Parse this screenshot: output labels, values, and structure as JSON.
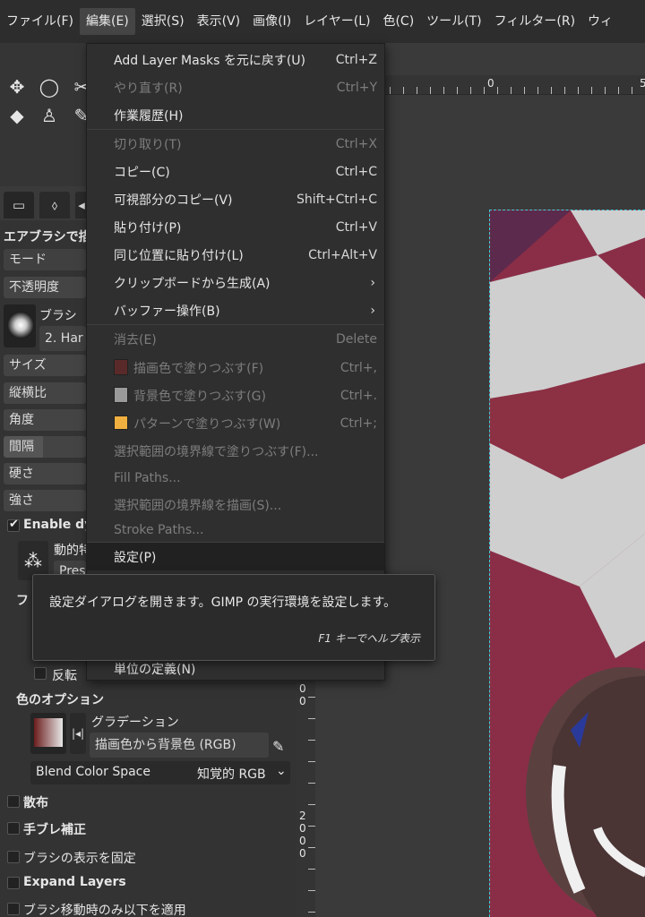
{
  "menubar": {
    "items": [
      "ファイル(F)",
      "編集(E)",
      "選択(S)",
      "表示(V)",
      "画像(I)",
      "レイヤー(L)",
      "色(C)",
      "ツール(T)",
      "フィルター(R)",
      "ウィ"
    ],
    "active_index": 1
  },
  "edit_menu": {
    "items": [
      {
        "label": "Add Layer Masks を元に戻す(U)",
        "accel": "Ctrl+Z",
        "disabled": false
      },
      {
        "label": "やり直す(R)",
        "accel": "Ctrl+Y",
        "disabled": true
      },
      {
        "label": "作業履歴(H)",
        "accel": "",
        "disabled": false
      },
      {
        "label": "切り取り(T)",
        "accel": "Ctrl+X",
        "disabled": true
      },
      {
        "label": "コピー(C)",
        "accel": "Ctrl+C",
        "disabled": false
      },
      {
        "label": "可視部分のコピー(V)",
        "accel": "Shift+Ctrl+C",
        "disabled": false
      },
      {
        "label": "貼り付け(P)",
        "accel": "Ctrl+V",
        "disabled": false
      },
      {
        "label": "同じ位置に貼り付け(L)",
        "accel": "Ctrl+Alt+V",
        "disabled": false
      },
      {
        "label": "クリップボードから生成(A)",
        "accel": "",
        "submenu": true,
        "disabled": false
      },
      {
        "label": "バッファー操作(B)",
        "accel": "",
        "submenu": true,
        "disabled": false
      },
      {
        "label": "消去(E)",
        "accel": "Delete",
        "disabled": true
      },
      {
        "label": "描画色で塗りつぶす(F)",
        "accel": "Ctrl+,",
        "disabled": true,
        "swatch": "#5a2a2a"
      },
      {
        "label": "背景色で塗りつぶす(G)",
        "accel": "Ctrl+.",
        "disabled": true,
        "swatch": "#9a9a9a"
      },
      {
        "label": "パターンで塗りつぶす(W)",
        "accel": "Ctrl+;",
        "disabled": true,
        "swatch": "#f0b040"
      },
      {
        "label": "選択範囲の境界線で塗りつぶす(F)...",
        "accel": "",
        "disabled": true
      },
      {
        "label": "Fill Paths...",
        "accel": "",
        "disabled": true
      },
      {
        "label": "選択範囲の境界線を描画(S)...",
        "accel": "",
        "disabled": true
      },
      {
        "label": "Stroke Paths...",
        "accel": "",
        "disabled": true
      },
      {
        "label": "設定(P)",
        "accel": "",
        "disabled": false,
        "hover": true
      },
      {
        "label": "単位の定義(N)",
        "accel": "",
        "disabled": false
      }
    ]
  },
  "tooltip": {
    "text": "設定ダイアログを開きます。GIMP の実行環境を設定します。",
    "help": "F1 キーでヘルプ表示"
  },
  "tool_options": {
    "title": "エアブラシで描",
    "mode": "モード",
    "opacity": "不透明度",
    "brush_label": "ブラシ",
    "brush_value": "2. Har",
    "size": "サイズ",
    "aspect": "縦横比",
    "angle": "角度",
    "spacing": "間隔",
    "hardness": "硬さ",
    "force": "強さ",
    "enable_dynamics": "Enable dy",
    "dynamics_label": "動的特",
    "dynamics_value": "Pres",
    "fade_label": "フ",
    "reverse": "反転",
    "color_options": "色のオプション",
    "gradient_label": "グラデーション",
    "gradient_value": "描画色から背景色 (RGB)",
    "blend_label": "Blend Color Space",
    "blend_value": "知覚的 RGB",
    "scatter": "散布",
    "smooth": "手ブレ補正",
    "lock_brush": "ブラシの表示を固定",
    "expand_layers": "Expand Layers",
    "apply_jitter": "ブラシ移動時のみ以下を適用"
  },
  "ruler": {
    "top_labels": [
      "0",
      "5"
    ],
    "left_labels": [
      "0",
      "0",
      "2",
      "0",
      "0",
      "0"
    ]
  },
  "colors": {
    "menu_bg": "#2f2f2f",
    "hover_bg": "#212121",
    "disabled": "#7d7d7d",
    "selection": "#3ad0d8"
  }
}
